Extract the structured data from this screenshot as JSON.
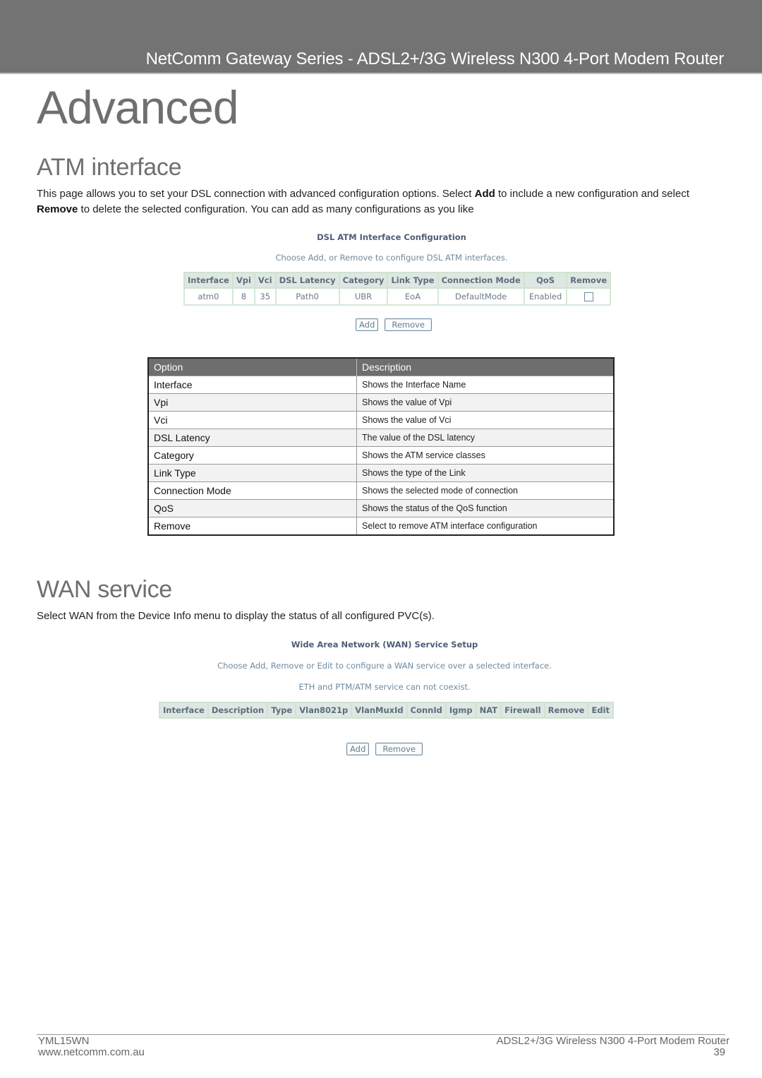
{
  "header": {
    "series_title": "NetComm Gateway Series - ADSL2+/3G Wireless N300 4-Port Modem Router"
  },
  "page_title": "Advanced",
  "atm_section": {
    "heading": "ATM interface",
    "intro": {
      "part1": "This page allows you to set your DSL connection with advanced configuration options. Select ",
      "bold1": "Add",
      "part2": " to include a new configuration and select ",
      "bold2": "Remove",
      "part3": " to delete the selected configuration. You can add as many configurations as you like"
    },
    "ui": {
      "title": "DSL ATM Interface Configuration",
      "subtitle": "Choose Add, or Remove to configure DSL ATM interfaces.",
      "columns": [
        "Interface",
        "Vpi",
        "Vci",
        "DSL Latency",
        "Category",
        "Link Type",
        "Connection Mode",
        "QoS",
        "Remove"
      ],
      "row": [
        "atm0",
        "8",
        "35",
        "Path0",
        "UBR",
        "EoA",
        "DefaultMode",
        "Enabled"
      ],
      "remove_checked": false,
      "add_label": "Add",
      "remove_label": "Remove"
    },
    "options_table": {
      "headers": [
        "Option",
        "Description"
      ],
      "rows": [
        {
          "option": "Interface",
          "description": "Shows the Interface Name"
        },
        {
          "option": "Vpi",
          "description": "Shows the value of Vpi"
        },
        {
          "option": "Vci",
          "description": "Shows the value of Vci"
        },
        {
          "option": "DSL Latency",
          "description": "The value of the DSL latency"
        },
        {
          "option": "Category",
          "description": "Shows the ATM service classes"
        },
        {
          "option": "Link Type",
          "description": "Shows the type of the Link"
        },
        {
          "option": "Connection Mode",
          "description": "Shows the selected mode of connection"
        },
        {
          "option": "QoS",
          "description": "Shows the status of the QoS function"
        },
        {
          "option": "Remove",
          "description": "Select to remove ATM interface configuration"
        }
      ]
    }
  },
  "wan_section": {
    "heading": "WAN service",
    "intro": "Select WAN from the Device Info menu to display the status of all configured PVC(s).",
    "ui": {
      "title": "Wide Area Network (WAN) Service Setup",
      "subtitle1": "Choose Add, Remove or Edit to configure a WAN service over a selected interface.",
      "subtitle2": "ETH and PTM/ATM service can not coexist.",
      "columns": [
        "Interface",
        "Description",
        "Type",
        "Vlan8021p",
        "VlanMuxId",
        "ConnId",
        "Igmp",
        "NAT",
        "Firewall",
        "Remove",
        "Edit"
      ],
      "add_label": "Add",
      "remove_label": "Remove"
    }
  },
  "footer": {
    "model": "YML15WN",
    "website": "www.netcomm.com.au",
    "product": "ADSL2+/3G Wireless N300 4-Port Modem Router",
    "page_number": "39"
  }
}
